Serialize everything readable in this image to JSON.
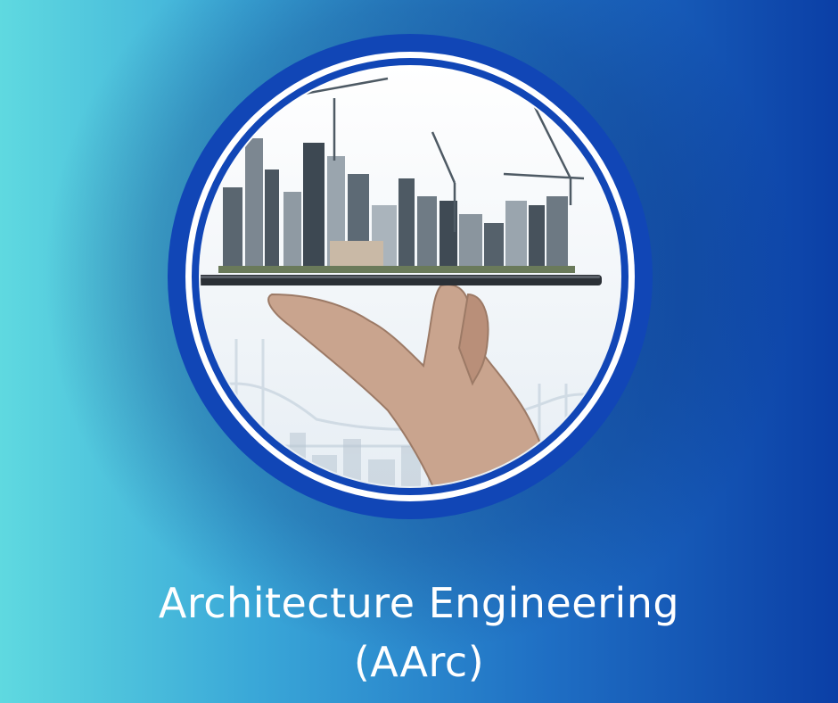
{
  "title": {
    "line1": "Architecture Engineering",
    "line2": "(AArc)"
  },
  "colors": {
    "background_left": "#5fd9e0",
    "background_right": "#0b3fa6",
    "ring_blue": "#1146b6",
    "title_text": "#ffffff"
  },
  "illustration": {
    "subject": "hand holding a tablet with a city skyline and construction cranes on top, bridge in the background",
    "icons": [
      "hand-icon",
      "tablet-icon",
      "skyline-icon",
      "crane-icon",
      "bridge-icon"
    ]
  }
}
